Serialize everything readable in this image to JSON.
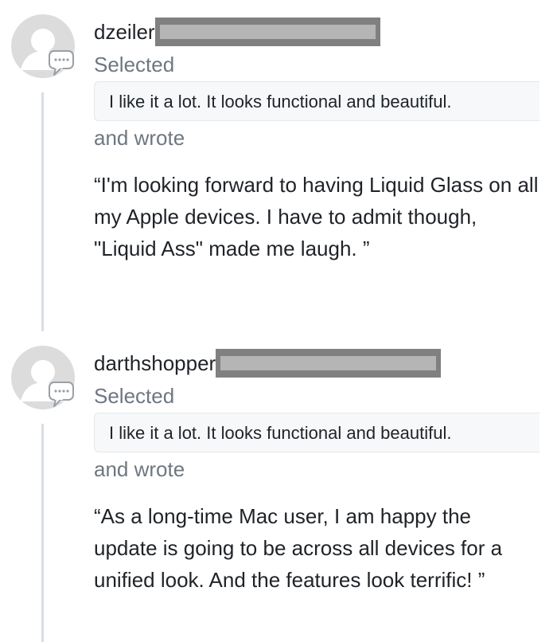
{
  "comments": [
    {
      "username": "dzeiler",
      "selected_label": "Selected",
      "choice": "I like it a lot. It looks functional and beautiful.",
      "wrote_label": "and wrote",
      "quote": "“I'm looking forward to having Liquid Glass on all my Apple devices. I have to admit though, \"Liquid Ass\" made me laugh. ”"
    },
    {
      "username": "darthshopper",
      "selected_label": "Selected",
      "choice": "I like it a lot. It looks functional and beautiful.",
      "wrote_label": "and wrote",
      "quote": "“As a long-time Mac user, I am happy the update is going to be across all devices for a unified look. And the features look terrific! ”"
    }
  ],
  "icons": {
    "avatar": "default-avatar-icon",
    "badge": "comment-bubble-icon"
  },
  "colors": {
    "muted_text": "#6e7781",
    "pill_bg": "#f6f8fa",
    "thread_line": "#d8dee4",
    "avatar_gray": "#dcdcdc",
    "redaction": "#808080"
  }
}
